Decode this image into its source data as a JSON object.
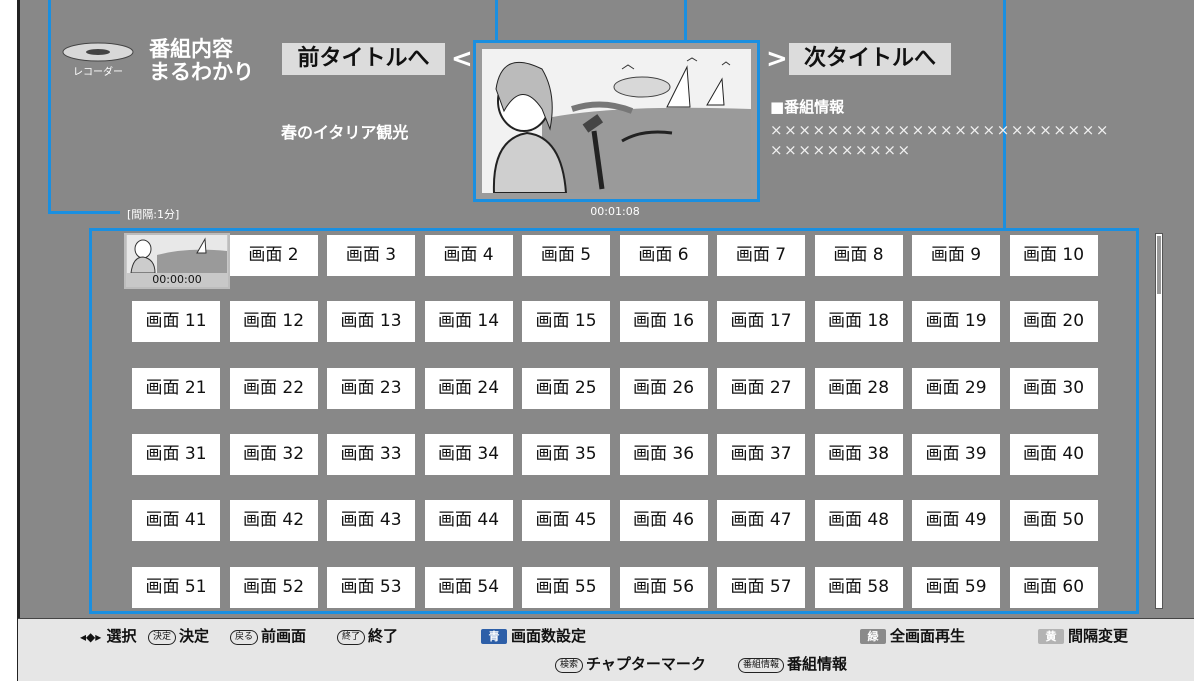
{
  "header": {
    "logo_text": "レコーダー",
    "app_title": "番組内容\nまるわかり",
    "prev_title_label": "前タイトルへ",
    "next_title_label": "次タイトルへ",
    "program_name": "春のイタリア観光",
    "preview_time": "00:01:08",
    "program_info_heading": "■番組情報",
    "program_info_text": "××××××××××××××××××××××××××××××××××"
  },
  "grid": {
    "interval_label": "[間隔:1分]",
    "first_thumb_time": "00:00:00",
    "cells": [
      "画面 2",
      "画面 3",
      "画面 4",
      "画面 5",
      "画面 6",
      "画面 7",
      "画面 8",
      "画面 9",
      "画面 10",
      "画面 11",
      "画面 12",
      "画面 13",
      "画面 14",
      "画面 15",
      "画面 16",
      "画面 17",
      "画面 18",
      "画面 19",
      "画面 20",
      "画面 21",
      "画面 22",
      "画面 23",
      "画面 24",
      "画面 25",
      "画面 26",
      "画面 27",
      "画面 28",
      "画面 29",
      "画面 30",
      "画面 31",
      "画面 32",
      "画面 33",
      "画面 34",
      "画面 35",
      "画面 36",
      "画面 37",
      "画面 38",
      "画面 39",
      "画面 40",
      "画面 41",
      "画面 42",
      "画面 43",
      "画面 44",
      "画面 45",
      "画面 46",
      "画面 47",
      "画面 48",
      "画面 49",
      "画面 50",
      "画面 51",
      "画面 52",
      "画面 53",
      "画面 54",
      "画面 55",
      "画面 56",
      "画面 57",
      "画面 58",
      "画面 59",
      "画面 60"
    ]
  },
  "footer": {
    "select_icon": "◂◆▸",
    "select_label": "選択",
    "enter_badge": "決定",
    "enter_label": "決定",
    "back_badge": "戻る",
    "back_label": "前画面",
    "exit_badge": "終了",
    "exit_label": "終了",
    "blue_key": "青",
    "blue_label": "画面数設定",
    "search_badge": "検索",
    "search_label": "チャプターマーク",
    "info_badge": "番組情報",
    "info_label": "番組情報",
    "green_key": "緑",
    "green_label": "全画面再生",
    "yellow_key": "黄",
    "yellow_label": "間隔変更"
  },
  "colors": {
    "accent": "#1a8fe0",
    "screen_bg": "#888888",
    "blue_key": "#2d5fa8",
    "green_key": "#8a8a8a",
    "yellow_key": "#b3b3b3"
  }
}
